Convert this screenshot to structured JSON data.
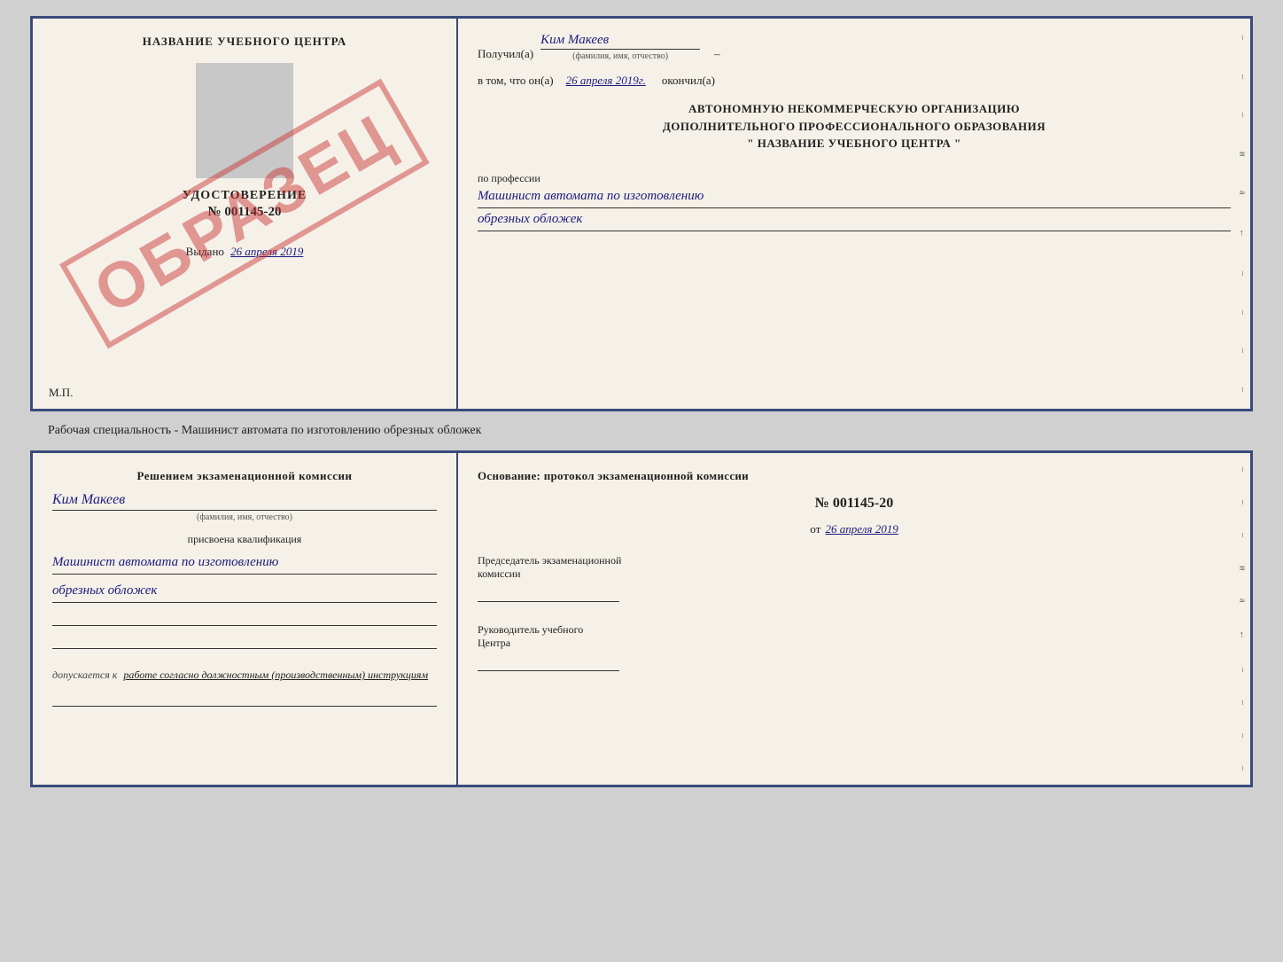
{
  "top_card": {
    "left": {
      "center_title": "НАЗВАНИЕ УЧЕБНОГО ЦЕНТРА",
      "cert_label": "УДОСТОВЕРЕНИЕ",
      "cert_number": "№ 001145-20",
      "issued_label": "Выдано",
      "issued_date": "26 апреля 2019",
      "mp_label": "М.П.",
      "watermark": "ОБРАЗЕЦ"
    },
    "right": {
      "received_label": "Получил(а)",
      "received_name": "Ким Макеев",
      "received_sub": "(фамилия, имя, отчество)",
      "in_that_label": "в том, что он(а)",
      "date_value": "26 апреля 2019г.",
      "finished_label": "окончил(а)",
      "org_line1": "АВТОНОМНУЮ НЕКОММЕРЧЕСКУЮ ОРГАНИЗАЦИЮ",
      "org_line2": "ДОПОЛНИТЕЛЬНОГО ПРОФЕССИОНАЛЬНОГО ОБРАЗОВАНИЯ",
      "org_line3": "\"  НАЗВАНИЕ УЧЕБНОГО ЦЕНТРА  \"",
      "profession_label": "по профессии",
      "profession_value_line1": "Машинист автомата по изготовлению",
      "profession_value_line2": "обрезных обложек",
      "edge_marks": [
        "–",
        "–",
        "–",
        "и",
        "а",
        "←",
        "–",
        "–",
        "–",
        "–"
      ]
    }
  },
  "caption": "Рабочая специальность - Машинист автомата по изготовлению обрезных обложек",
  "bottom_card": {
    "left": {
      "resolve_text": "Решением экзаменационной комиссии",
      "name_value": "Ким Макеев",
      "name_sub": "(фамилия, имя, отчество)",
      "assigned_label": "присвоена квалификация",
      "qual_line1": "Машинист автомата по изготовлению",
      "qual_line2": "обрезных обложек",
      "line3": "",
      "line4": "",
      "допуск_prefix": "допускается к",
      "допуск_value": "работе согласно должностным (производственным) инструкциям"
    },
    "right": {
      "base_label": "Основание: протокол экзаменационной комиссии",
      "protocol_num": "№ 001145-20",
      "protocol_date_prefix": "от",
      "protocol_date": "26 апреля 2019",
      "chair_label_line1": "Председатель экзаменационной",
      "chair_label_line2": "комиссии",
      "head_label_line1": "Руководитель учебного",
      "head_label_line2": "Центра",
      "edge_marks": [
        "–",
        "–",
        "–",
        "и",
        "а",
        "←",
        "–",
        "–",
        "–",
        "–"
      ]
    }
  }
}
